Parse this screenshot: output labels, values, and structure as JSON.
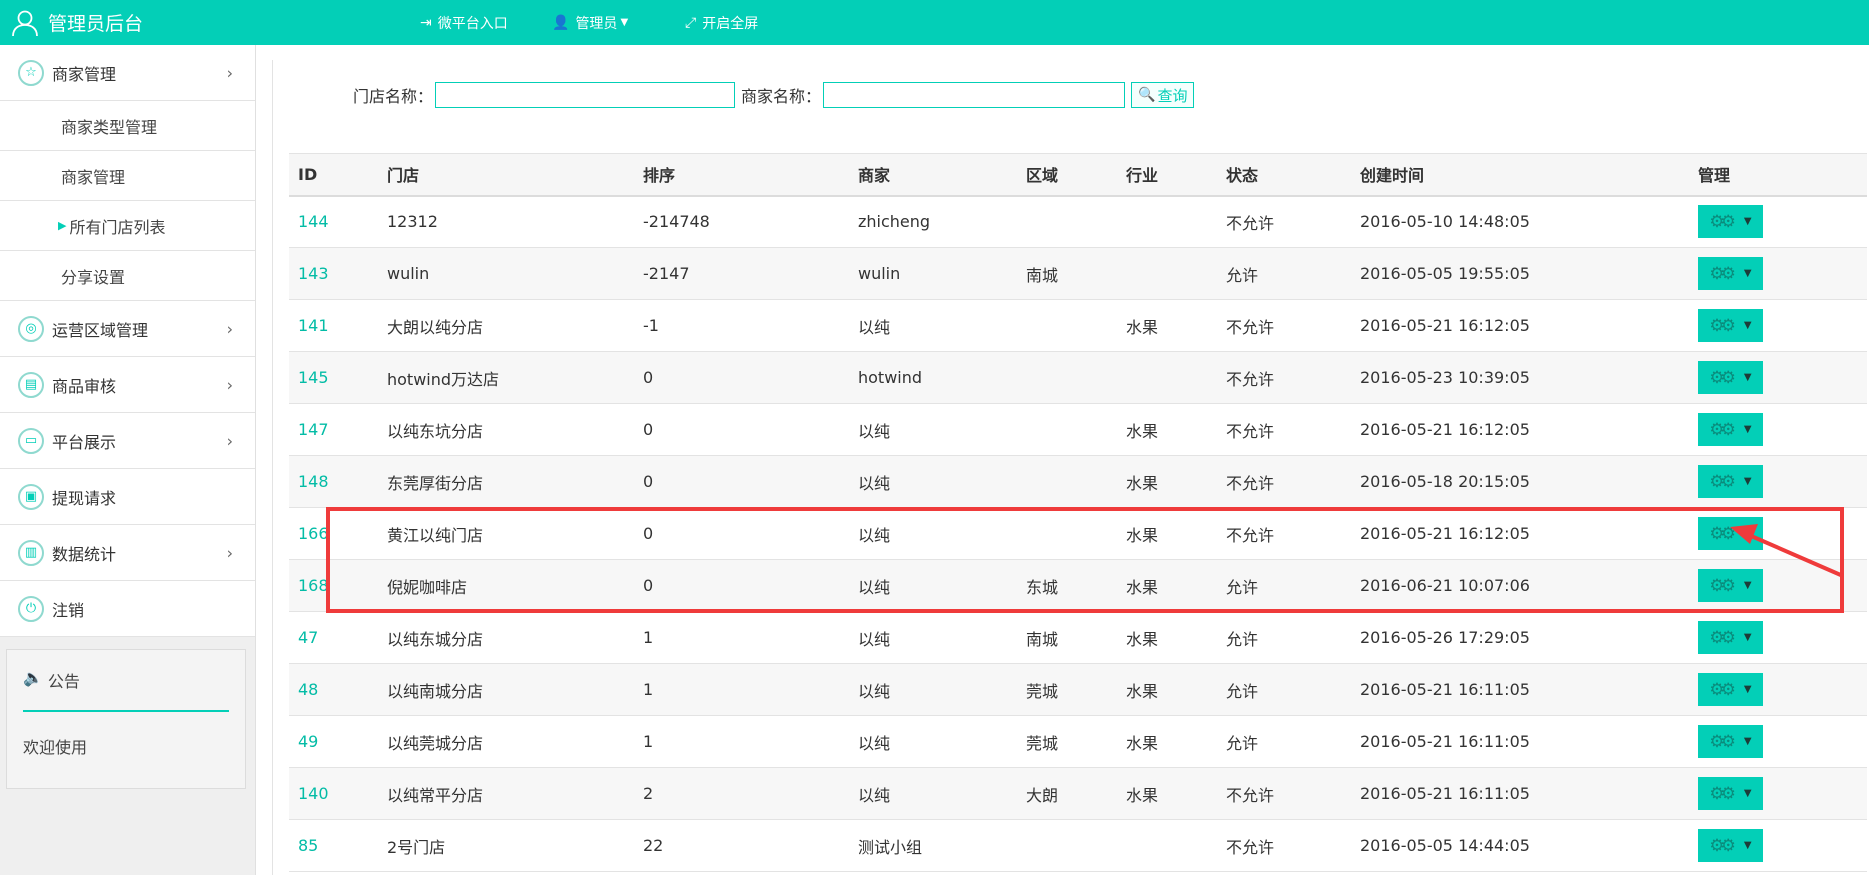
{
  "header": {
    "title": "管理员后台",
    "nav": [
      {
        "label": "微平台入口",
        "icon": "enter-icon"
      },
      {
        "label": "管理员",
        "icon": "admin-user-icon"
      },
      {
        "label": "开启全屏",
        "icon": "fullscreen-icon"
      }
    ]
  },
  "sidebar": {
    "merchant_mgmt": "商家管理",
    "sub_items": [
      "商家类型管理",
      "商家管理",
      "所有门店列表",
      "分享设置"
    ],
    "items": [
      "运营区域管理",
      "商品审核",
      "平台展示",
      "提现请求",
      "数据统计",
      "注销"
    ],
    "notice_title": "公告",
    "notice_body": "欢迎使用"
  },
  "search": {
    "store_label": "门店名称：",
    "merchant_label": "商家名称：",
    "store_value": "",
    "merchant_value": "",
    "button": "查询"
  },
  "table": {
    "columns": [
      "ID",
      "门店",
      "排序",
      "商家",
      "区域",
      "行业",
      "状态",
      "创建时间",
      "管理"
    ],
    "rows": [
      {
        "id": "144",
        "store": "12312",
        "order": "-214748",
        "merchant": "zhicheng",
        "region": "",
        "industry": "",
        "status": "不允许",
        "created": "2016-05-10 14:48:05"
      },
      {
        "id": "143",
        "store": "wulin",
        "order": "-2147",
        "merchant": "wulin",
        "region": "南城",
        "industry": "",
        "status": "允许",
        "created": "2016-05-05 19:55:05"
      },
      {
        "id": "141",
        "store": "大朗以纯分店",
        "order": "-1",
        "merchant": "以纯",
        "region": "",
        "industry": "水果",
        "status": "不允许",
        "created": "2016-05-21 16:12:05"
      },
      {
        "id": "145",
        "store": "hotwind万达店",
        "order": "0",
        "merchant": "hotwind",
        "region": "",
        "industry": "",
        "status": "不允许",
        "created": "2016-05-23 10:39:05"
      },
      {
        "id": "147",
        "store": "以纯东坑分店",
        "order": "0",
        "merchant": "以纯",
        "region": "",
        "industry": "水果",
        "status": "不允许",
        "created": "2016-05-21 16:12:05"
      },
      {
        "id": "148",
        "store": "东莞厚街分店",
        "order": "0",
        "merchant": "以纯",
        "region": "",
        "industry": "水果",
        "status": "不允许",
        "created": "2016-05-18 20:15:05"
      },
      {
        "id": "166",
        "store": "黄江以纯门店",
        "order": "0",
        "merchant": "以纯",
        "region": "",
        "industry": "水果",
        "status": "不允许",
        "created": "2016-05-21 16:12:05"
      },
      {
        "id": "168",
        "store": "倪妮咖啡店",
        "order": "0",
        "merchant": "以纯",
        "region": "东城",
        "industry": "水果",
        "status": "允许",
        "created": "2016-06-21 10:07:06"
      },
      {
        "id": "47",
        "store": "以纯东城分店",
        "order": "1",
        "merchant": "以纯",
        "region": "南城",
        "industry": "水果",
        "status": "允许",
        "created": "2016-05-26 17:29:05"
      },
      {
        "id": "48",
        "store": "以纯南城分店",
        "order": "1",
        "merchant": "以纯",
        "region": "莞城",
        "industry": "水果",
        "status": "允许",
        "created": "2016-05-21 16:11:05"
      },
      {
        "id": "49",
        "store": "以纯莞城分店",
        "order": "1",
        "merchant": "以纯",
        "region": "莞城",
        "industry": "水果",
        "status": "允许",
        "created": "2016-05-21 16:11:05"
      },
      {
        "id": "140",
        "store": "以纯常平分店",
        "order": "2",
        "merchant": "以纯",
        "region": "大朗",
        "industry": "水果",
        "status": "不允许",
        "created": "2016-05-21 16:11:05"
      },
      {
        "id": "85",
        "store": "2号门店",
        "order": "22",
        "merchant": "测试小组",
        "region": "",
        "industry": "",
        "status": "不允许",
        "created": "2016-05-05 14:44:05"
      }
    ]
  },
  "colors": {
    "accent": "#03cfb7",
    "annotation": "#ef3b3b"
  }
}
